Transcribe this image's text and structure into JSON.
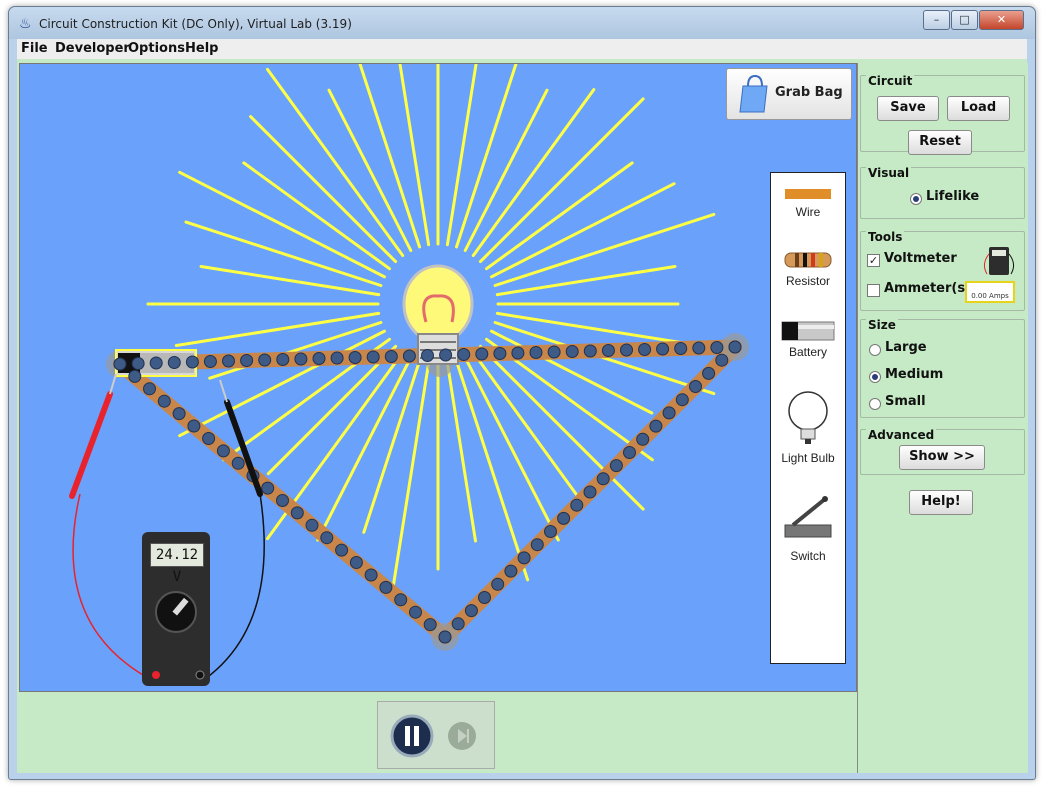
{
  "window": {
    "title": "Circuit Construction Kit (DC Only), Virtual Lab (3.19)",
    "minimize_glyph": "–",
    "maximize_glyph": "□",
    "close_glyph": "✕"
  },
  "menu": [
    "File",
    "Developer",
    "Options",
    "Help"
  ],
  "grab_bag": {
    "label": "Grab Bag",
    "icon": "shopping-bag-icon"
  },
  "toolbox": {
    "items": [
      {
        "label": "Wire",
        "icon": "wire-icon"
      },
      {
        "label": "Resistor",
        "icon": "resistor-icon"
      },
      {
        "label": "Battery",
        "icon": "battery-icon"
      },
      {
        "label": "Light Bulb",
        "icon": "light-bulb-icon"
      },
      {
        "label": "Switch",
        "icon": "switch-icon"
      }
    ]
  },
  "voltmeter": {
    "reading": "24.12 V"
  },
  "circuit_group": {
    "title": "Circuit",
    "save": "Save",
    "load": "Load",
    "reset": "Reset"
  },
  "visual_group": {
    "title": "Visual",
    "options": [
      {
        "label": "Lifelike",
        "selected": true
      }
    ]
  },
  "tools_group": {
    "title": "Tools",
    "voltmeter": {
      "label": "Voltmeter",
      "checked": true
    },
    "ammeter": {
      "label": "Ammeter(s)",
      "checked": false,
      "icon_text": "0.00 Amps"
    }
  },
  "size_group": {
    "title": "Size",
    "options": [
      {
        "label": "Large",
        "selected": false
      },
      {
        "label": "Medium",
        "selected": true
      },
      {
        "label": "Small",
        "selected": false
      }
    ]
  },
  "advanced_group": {
    "title": "Advanced",
    "show": "Show >>"
  },
  "help_button": "Help!",
  "clock_controls": {
    "pause_icon": "pause-icon",
    "step_icon": "step-icon"
  },
  "colors": {
    "canvas_background": "#6aa2fb",
    "panel_background": "#c5eac5",
    "wire": "#c8864a",
    "light_rays": "#ffff44",
    "electrons": "#3e5a86"
  }
}
